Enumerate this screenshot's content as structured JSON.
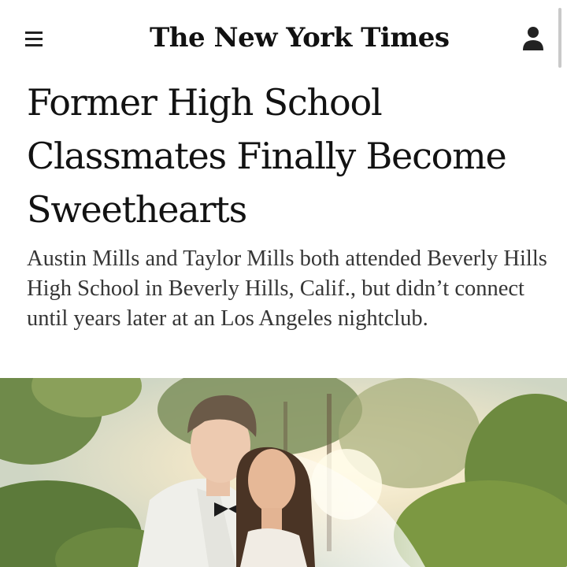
{
  "header": {
    "masthead": "The New York Times",
    "menu_icon": "hamburger-menu-icon",
    "account_icon": "account-person-icon"
  },
  "article": {
    "headline": "Former High School Classmates Finally Become Sweethearts",
    "summary": "Austin Mills and Taylor Mills both attended Beverly Hills High School in Beverly Hills, Calif., but didn’t connect until years later at an Los Angeles nightclub."
  },
  "colors": {
    "text": "#121212",
    "summary_text": "#363636",
    "background": "#ffffff"
  }
}
